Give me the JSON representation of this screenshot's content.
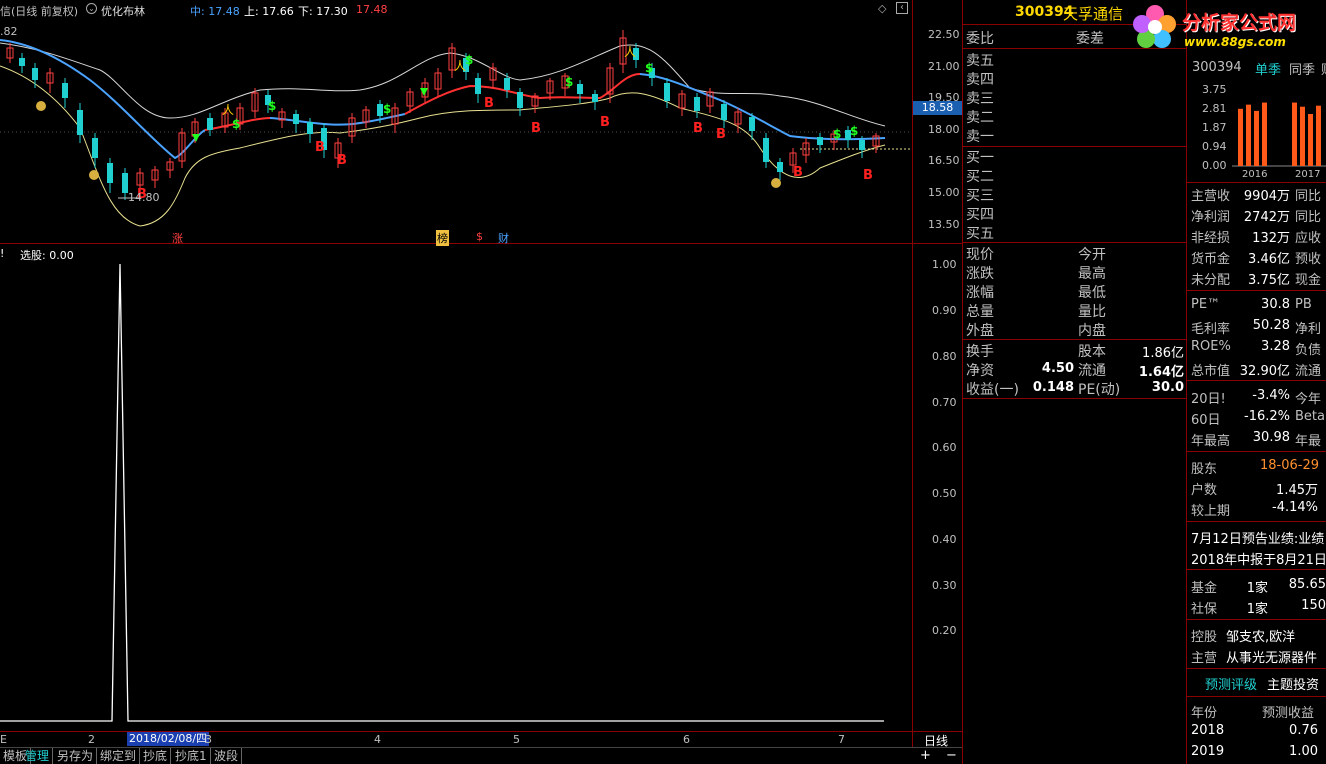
{
  "chart_header": {
    "title": "信(日线 前复权)",
    "indicator": "优化布林",
    "mid_label": "中: 17.48",
    "up_label": "上: 17.66",
    "down_label": "下: 17.30",
    "extra_value": "17.48"
  },
  "price_axis": [
    "22.50",
    "21.00",
    "19.50",
    "18.00",
    "16.50",
    "15.00",
    "13.50"
  ],
  "current_price_tag": "18.58",
  "low_mark": "14.80",
  "top_left_value": ".82",
  "event_tags": [
    "涨",
    "榜",
    "$",
    "财"
  ],
  "oscillator": {
    "title_prefix": "!",
    "title": "选股: 0.00",
    "axis": [
      "1.00",
      "0.90",
      "0.80",
      "0.70",
      "0.60",
      "0.50",
      "0.40",
      "0.30",
      "0.20"
    ]
  },
  "x_axis": {
    "labels": [
      "2",
      "3",
      "4",
      "5",
      "6",
      "7"
    ],
    "highlight_date": "2018/02/08/四",
    "left_edge": "E",
    "period": "日线"
  },
  "toolbar": {
    "buttons": [
      "模板",
      "管理",
      "另存为",
      "绑定到",
      "抄底",
      "抄底1",
      "波段"
    ],
    "zoom_in": "+",
    "zoom_out": "−"
  },
  "quote": {
    "code": "300394",
    "name": "天孚通信",
    "order_ratio": "委比",
    "order_diff": "委差",
    "sell": [
      "卖五",
      "卖四",
      "卖三",
      "卖二",
      "卖一"
    ],
    "buy": [
      "买一",
      "买二",
      "买三",
      "买四",
      "买五"
    ],
    "stats_left": [
      "现价",
      "涨跌",
      "涨幅",
      "总量",
      "外盘"
    ],
    "stats_right": [
      "今开",
      "最高",
      "最低",
      "量比",
      "内盘"
    ],
    "turnover_label": "换手",
    "share_capital_label": "股本",
    "share_capital": "1.86亿",
    "net_asset_label": "净资",
    "net_asset": "4.50",
    "float_label": "流通",
    "float_value": "1.64亿",
    "eps_label": "收益(一)",
    "eps": "0.148",
    "pe_label": "PE(动)",
    "pe": "30.0"
  },
  "watermark": {
    "title": "分析家公式网",
    "url": "www.88gs.com"
  },
  "finance": {
    "code": "300394",
    "tabs": [
      "单季",
      "同季",
      "财"
    ],
    "bar_axis": [
      "3.75",
      "2.81",
      "1.87",
      "0.94",
      "0.00"
    ],
    "bar_years": [
      "2016",
      "2017"
    ],
    "bars_2016": [
      2.75,
      2.95,
      2.65,
      3.05
    ],
    "bars_2017": [
      3.05,
      2.85,
      2.5,
      2.9
    ],
    "rows1": [
      {
        "label": "主营收",
        "value": "9904万",
        "extra": "同比"
      },
      {
        "label": "净利润",
        "value": "2742万",
        "extra": "同比"
      },
      {
        "label": "非经损",
        "value": "132万",
        "extra": "应收"
      },
      {
        "label": "货币金",
        "value": "3.46亿",
        "extra": "预收"
      },
      {
        "label": "未分配",
        "value": "3.75亿",
        "extra": "现金"
      }
    ],
    "rows2": [
      {
        "label": "PE™",
        "value": "30.8",
        "extra": "PB"
      },
      {
        "label": "毛利率",
        "value": "50.28",
        "extra": "净利"
      },
      {
        "label": "ROE%",
        "value": "3.28",
        "extra": "负债"
      },
      {
        "label": "总市值",
        "value": "32.90亿",
        "extra": "流通"
      }
    ],
    "rows3": [
      {
        "label": "20日!",
        "value": "-3.4%",
        "extra": "今年"
      },
      {
        "label": "60日",
        "value": "-16.2%",
        "extra": "Beta"
      },
      {
        "label": "年最高",
        "value": "30.98",
        "extra": "年最"
      }
    ],
    "holder_label": "股东",
    "holder_date": "18-06-29",
    "households_label": "户数",
    "households": "1.45万",
    "change_label": "较上期",
    "change": "-4.14%",
    "notice1": "7月12日预告业绩:业绩",
    "notice2": "2018年中报于8月21日",
    "fund_label": "基金",
    "fund_count": "1家",
    "fund_value": "85.65",
    "ss_label": "社保",
    "ss_count": "1家",
    "ss_value": "150",
    "control_label": "控股",
    "control_value": "邹支农,欧洋",
    "business_label": "主营",
    "business_value": "从事光无源器件",
    "tab_forecast": "预测评级",
    "tab_theme": "主题投资",
    "forecast_header_year": "年份",
    "forecast_header_eps": "预测收益",
    "forecast": [
      {
        "year": "2018",
        "eps": "0.76"
      },
      {
        "year": "2019",
        "eps": "1.00"
      }
    ]
  }
}
